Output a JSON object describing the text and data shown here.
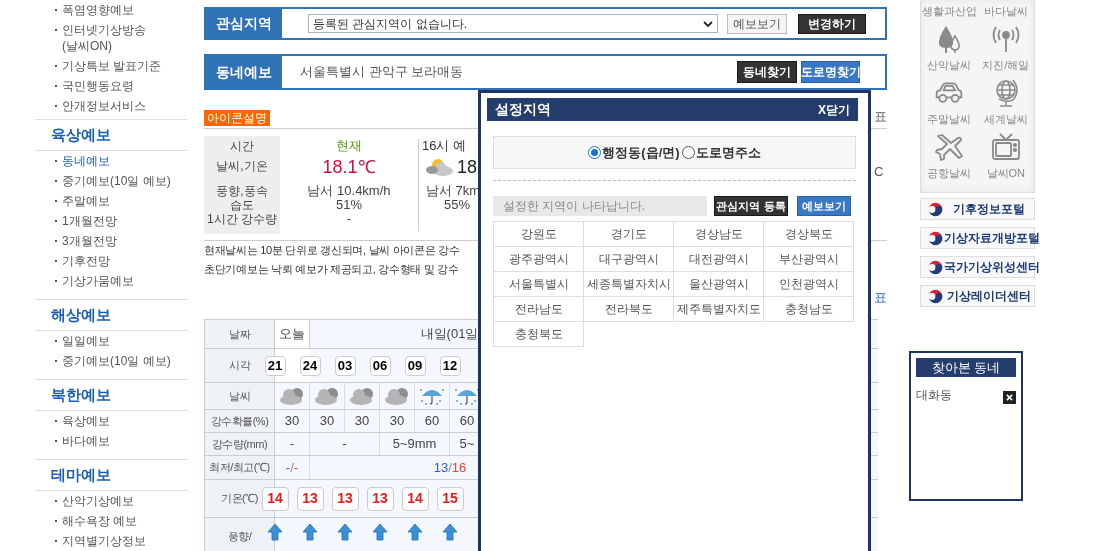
{
  "sidebar": {
    "top_items": [
      {
        "label": "폭염영향예보",
        "selected": false
      },
      {
        "label": "인터넷기상방송 (날씨ON)",
        "selected": false
      },
      {
        "label": "기상특보 발표기준",
        "selected": false
      },
      {
        "label": "국민행동요령",
        "selected": false
      },
      {
        "label": "안개정보서비스",
        "selected": false
      }
    ],
    "sections": [
      {
        "heading": "육상예보",
        "items": [
          {
            "label": "동네예보",
            "selected": true
          },
          {
            "label": "중기예보(10일 예보)",
            "selected": false
          },
          {
            "label": "주말예보",
            "selected": false
          },
          {
            "label": "1개월전망",
            "selected": false
          },
          {
            "label": "3개월전망",
            "selected": false
          },
          {
            "label": "기후전망",
            "selected": false
          },
          {
            "label": "기상가뭄예보",
            "selected": false
          }
        ]
      },
      {
        "heading": "해상예보",
        "items": [
          {
            "label": "일일예보",
            "selected": false
          },
          {
            "label": "중기예보(10일 예보)",
            "selected": false
          }
        ]
      },
      {
        "heading": "북한예보",
        "items": [
          {
            "label": "육상예보",
            "selected": false
          },
          {
            "label": "바다예보",
            "selected": false
          }
        ]
      },
      {
        "heading": "테마예보",
        "items": [
          {
            "label": "산악기상예보",
            "selected": false
          },
          {
            "label": "해수욕장 예보",
            "selected": false
          },
          {
            "label": "지역별기상정보",
            "selected": false
          }
        ]
      }
    ]
  },
  "interest": {
    "label": "관심지역",
    "select_value": "등록된 관심지역이 없습니다.",
    "buttons": [
      {
        "label": "예보보기",
        "kind": "light"
      },
      {
        "label": "변경하기",
        "kind": "dark"
      }
    ]
  },
  "local": {
    "label": "동네예보",
    "address": "서울특별시 관악구 보라매동",
    "buttons": [
      {
        "label": "동네찾기",
        "kind": "dark"
      },
      {
        "label": "도로명찾기",
        "kind": "blue"
      }
    ]
  },
  "icon_legend": "아이콘설명",
  "current": {
    "header_labels": [
      "시간",
      "날씨,기온",
      "풍향,풍속",
      "습도",
      "1시간 강수량"
    ],
    "now": {
      "title": "현재",
      "temp": "18.1℃",
      "wind": "남서 10.4km/h",
      "humidity": "51%",
      "rain": "-"
    },
    "forecast": {
      "title": "16시 예",
      "temp": "18",
      "wind": "남서 7km",
      "humidity": "55%"
    }
  },
  "edge_fragments": [
    {
      "text": "표",
      "kind": "plain"
    },
    {
      "text": "C",
      "kind": "plain"
    },
    {
      "text": "표",
      "kind": "link"
    }
  ],
  "notes": [
    "현재날씨는 10분 단위로 갱신되며, 날씨 아이콘은 강수",
    "초단기예보는 낙뢰 예보가 제공되고, 강수형태 및 강수"
  ],
  "forecast_table": {
    "date_row": {
      "label": "날짜",
      "cells": [
        {
          "text": "오늘"
        },
        {
          "text": "내일(01일"
        }
      ]
    },
    "time_row": {
      "label": "시각",
      "values": [
        "21",
        "24",
        "03",
        "06",
        "09",
        "12"
      ]
    },
    "weather_row": {
      "label": "날씨",
      "icons": [
        {
          "kind": "cloudy"
        },
        {
          "kind": "cloudy"
        },
        {
          "kind": "cloudy"
        },
        {
          "kind": "cloudy"
        },
        {
          "kind": "rain"
        },
        {
          "kind": "rain"
        }
      ]
    },
    "pop_row": {
      "label": "강수확률(%)",
      "values": [
        "30",
        "30",
        "30",
        "30",
        "60",
        "60"
      ]
    },
    "rain_row": {
      "label": "강수량(mm)",
      "cells": [
        {
          "text": "-"
        },
        {
          "text": "-"
        },
        {
          "text": "5~9mm"
        },
        {
          "text": "5~"
        }
      ]
    },
    "minmax_row": {
      "label": "최저/최고(℃)",
      "cells": [
        {
          "low": "-",
          "separator": "/",
          "high": "-"
        },
        {
          "low": "13",
          "separator": "/",
          "high": "16"
        }
      ]
    },
    "temp_row": {
      "label": "기온(℃)",
      "values": [
        "14",
        "13",
        "13",
        "13",
        "14",
        "15"
      ]
    },
    "wind_row": {
      "label": "풍향/",
      "arrows": [
        {
          "kind": "up"
        },
        {
          "kind": "up"
        },
        {
          "kind": "up"
        },
        {
          "kind": "up"
        },
        {
          "kind": "up"
        },
        {
          "kind": "up"
        }
      ]
    }
  },
  "popup": {
    "title": "설정지역",
    "close": "X닫기",
    "address_types": [
      {
        "label": "행정동(읍/면)",
        "selected": true
      },
      {
        "label": "도로명주소",
        "selected": false
      }
    ],
    "selected_area": {
      "placeholder": "설정한 지역이 나타납니다."
    },
    "buttons": [
      {
        "label": "관심지역 등록",
        "kind": "dark"
      },
      {
        "label": "예보보기",
        "kind": "blue"
      }
    ],
    "regions": [
      "강원도",
      "경기도",
      "경상남도",
      "경상북도",
      "광주광역시",
      "대구광역시",
      "대전광역시",
      "부산광역시",
      "서울특별시",
      "세종특별자치시",
      "울산광역시",
      "인천광역시",
      "전라남도",
      "전라북도",
      "제주특별자치도",
      "충청남도",
      "충청북도"
    ]
  },
  "quick_menu": [
    {
      "label": "생활과산업",
      "kind": "label_only"
    },
    {
      "label": "바다날씨",
      "kind": "label_only"
    },
    {
      "label": "산악날씨",
      "kind": "mountain"
    },
    {
      "label": "지진/해일",
      "kind": "antenna"
    },
    {
      "label": "주말날씨",
      "kind": "car"
    },
    {
      "label": "세계날씨",
      "kind": "globe"
    },
    {
      "label": "공항날씨",
      "kind": "plane"
    },
    {
      "label": "날씨ON",
      "kind": "tv"
    }
  ],
  "portal_links": [
    {
      "label": "기후정보포털"
    },
    {
      "label": "기상자료개방포털"
    },
    {
      "label": "국가기상위성센터"
    },
    {
      "label": "기상레이더센터"
    }
  ],
  "recent": {
    "title": "찾아본 동네",
    "items": [
      {
        "name": "대화동"
      }
    ]
  }
}
